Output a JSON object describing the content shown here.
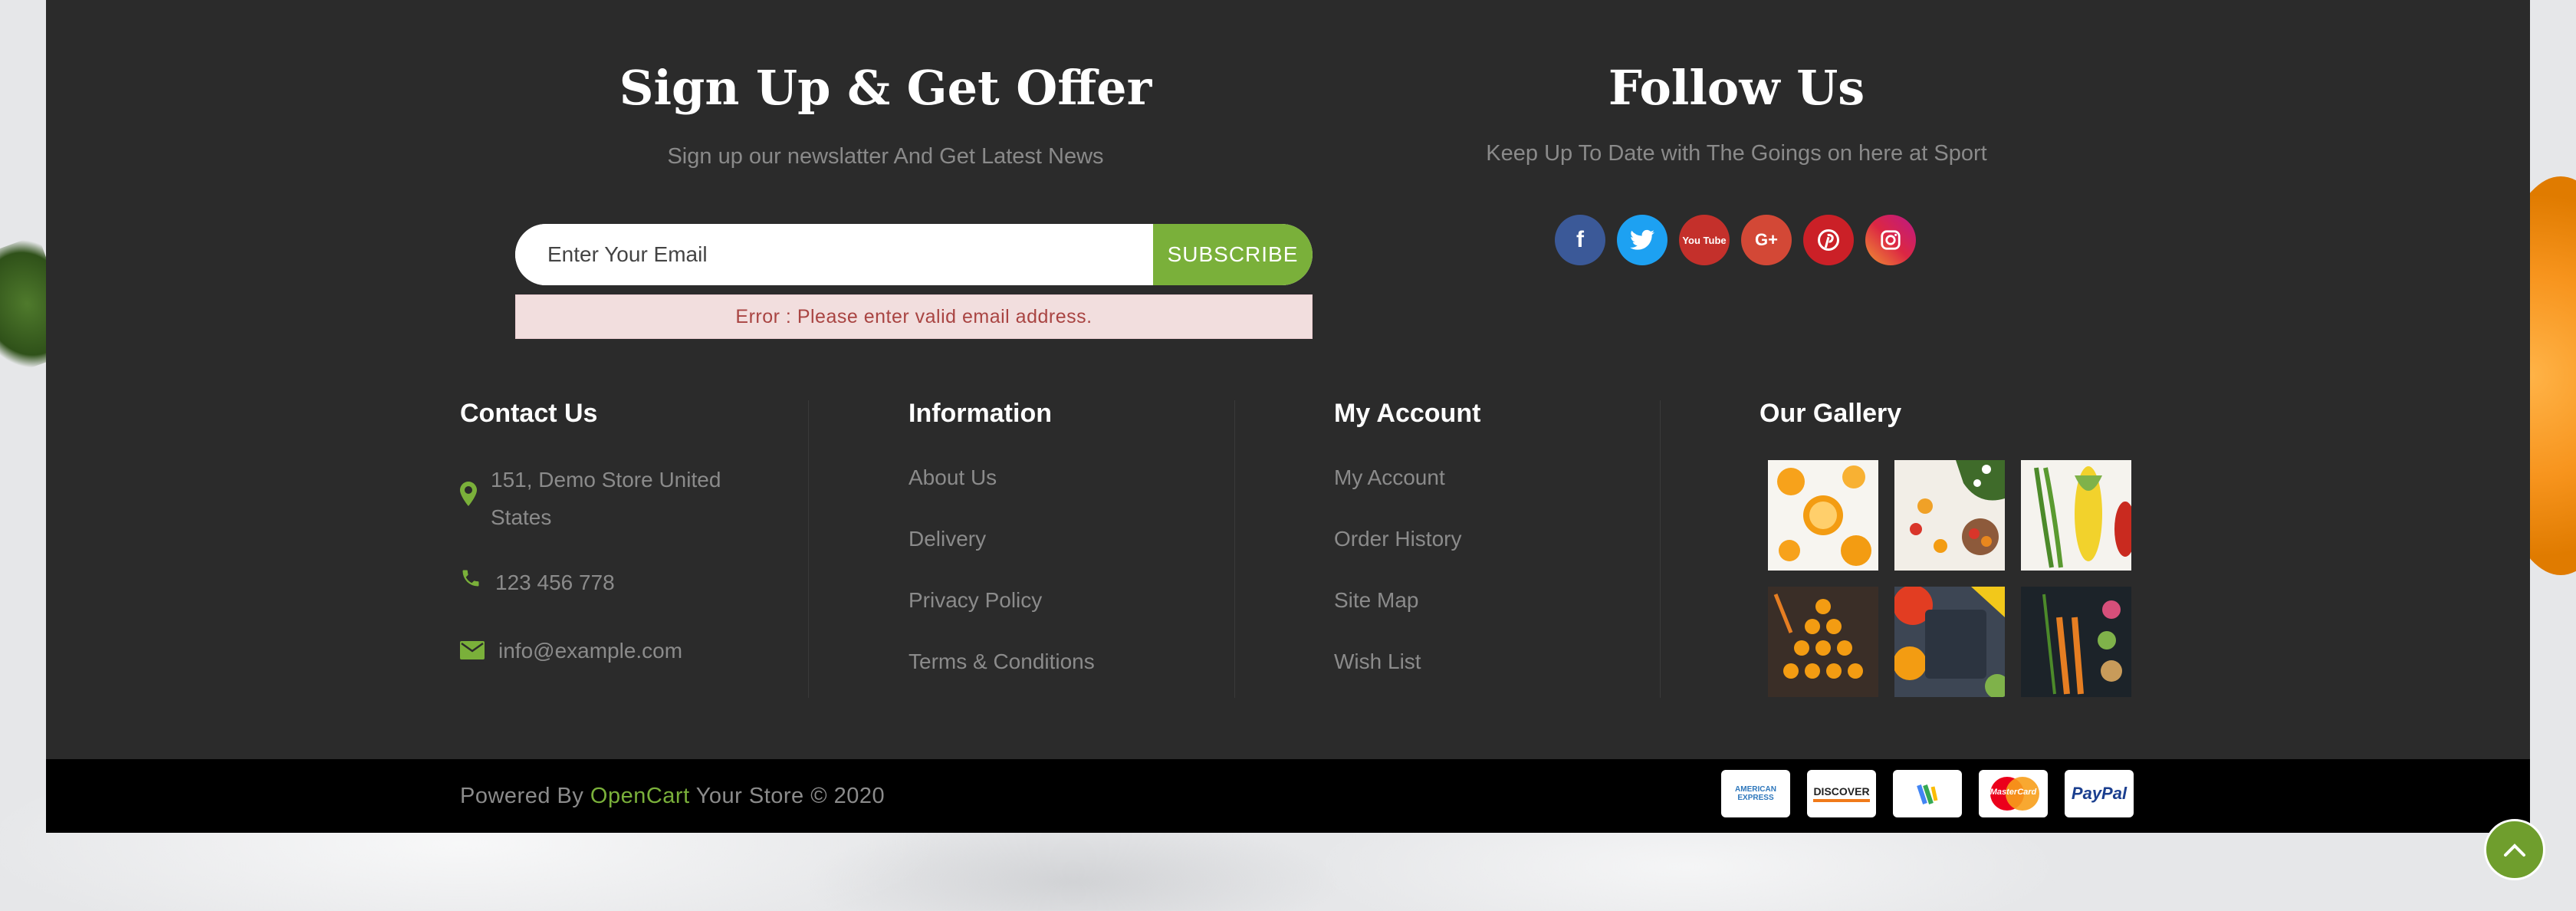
{
  "newsletter": {
    "title": "Sign Up & Get Offer",
    "subtitle": "Sign up our newslatter And Get Latest News",
    "email_placeholder": "Enter Your Email",
    "subscribe_label": "SUBSCRIBE",
    "error": "Error : Please enter valid email address."
  },
  "follow": {
    "title": "Follow Us",
    "subtitle": "Keep Up To Date with The Goings on here at Sport",
    "networks": [
      "facebook-icon",
      "twitter-icon",
      "youtube-icon",
      "google-plus-icon",
      "pinterest-icon",
      "instagram-icon"
    ],
    "youtube_text": "You Tube",
    "google_text": "G+"
  },
  "contact": {
    "title": "Contact Us",
    "address_line1": "151, Demo Store United",
    "address_line2": "States",
    "phone": "123 456 778",
    "email": "info@example.com"
  },
  "information": {
    "title": "Information",
    "links": [
      "About Us",
      "Delivery",
      "Privacy Policy",
      "Terms & Conditions"
    ]
  },
  "account": {
    "title": "My Account",
    "links": [
      "My Account",
      "Order History",
      "Site Map",
      "Wish List"
    ]
  },
  "gallery": {
    "title": "Our Gallery",
    "items": [
      "orange-slices",
      "fruits-and-flowers",
      "beans-and-corn",
      "orange-pyramid",
      "vegetables-on-slate",
      "carrots-and-radishes"
    ]
  },
  "bottom": {
    "powered_prefix": "Powered By",
    "powered_link": "OpenCart",
    "powered_suffix": "Your Store © 2020",
    "payments": {
      "amex": "AMERICAN EXPRESS",
      "discover": "DISCOVER",
      "mastercard": "MasterCard",
      "paypal": "PayPal"
    }
  },
  "colors": {
    "accent": "#7ab03a",
    "footer_bg": "#2b2b2b",
    "bottom_bg": "#000000",
    "error_bg": "#f2dede",
    "error_text": "#a94442"
  }
}
